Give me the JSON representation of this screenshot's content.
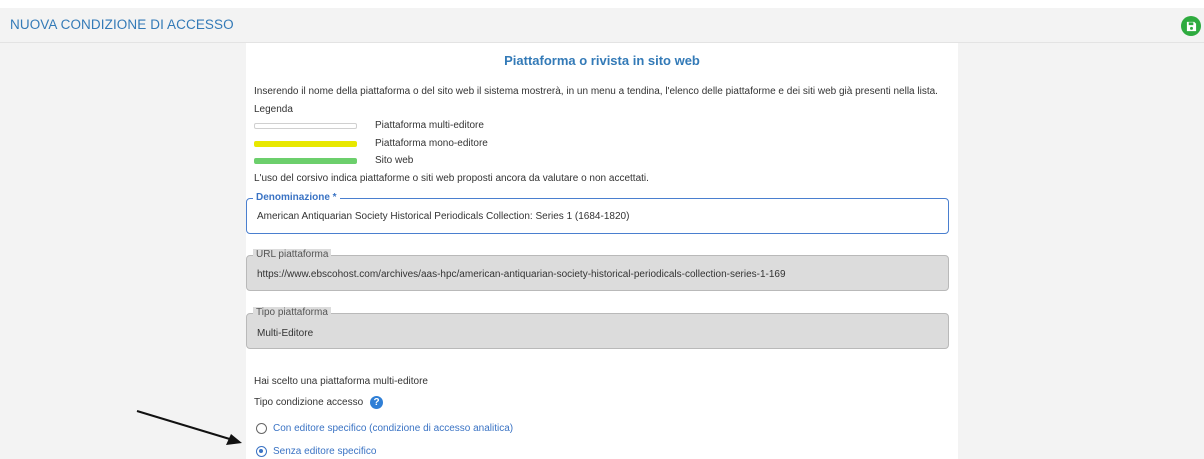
{
  "header": {
    "title": "NUOVA CONDIZIONE DI ACCESSO",
    "save_icon": "floppy-disk-icon"
  },
  "section": {
    "title": "Piattaforma o rivista in sito web",
    "intro": "Inserendo il nome della piattaforma o del sito web il sistema mostrerà, in un menu a tendina, l'elenco delle piattaforme e dei siti web già presenti nella lista.",
    "legend_title": "Legenda",
    "legend": [
      {
        "label": "Piattaforma multi-editore",
        "color": "#ffffff"
      },
      {
        "label": "Piattaforma mono-editore",
        "color": "#e8e800"
      },
      {
        "label": "Sito web",
        "color": "#6ccf6c"
      }
    ],
    "italic_note": "L'uso del corsivo indica piattaforme o siti web proposti ancora da valutare o non accettati."
  },
  "fields": {
    "denominazione": {
      "label": "Denominazione *",
      "value": "American Antiquarian Society Historical Periodicals Collection: Series 1 (1684-1820)"
    },
    "url": {
      "label": "URL piattaforma",
      "value": "https://www.ebscohost.com/archives/aas-hpc/american-antiquarian-society-historical-periodicals-collection-series-1-169"
    },
    "tipo": {
      "label": "Tipo piattaforma",
      "value": "Multi-Editore"
    }
  },
  "choice": {
    "message": "Hai scelto una piattaforma multi-editore",
    "access_type_label": "Tipo condizione accesso",
    "help_icon": "question-circle-icon",
    "options": [
      {
        "label": "Con editore specifico (condizione di accesso analitica)",
        "selected": false
      },
      {
        "label": "Senza editore specifico",
        "selected": true
      }
    ]
  },
  "colors": {
    "accent": "#337ab7",
    "save": "#2eab3f",
    "radio_selected": "#3a73c4"
  }
}
